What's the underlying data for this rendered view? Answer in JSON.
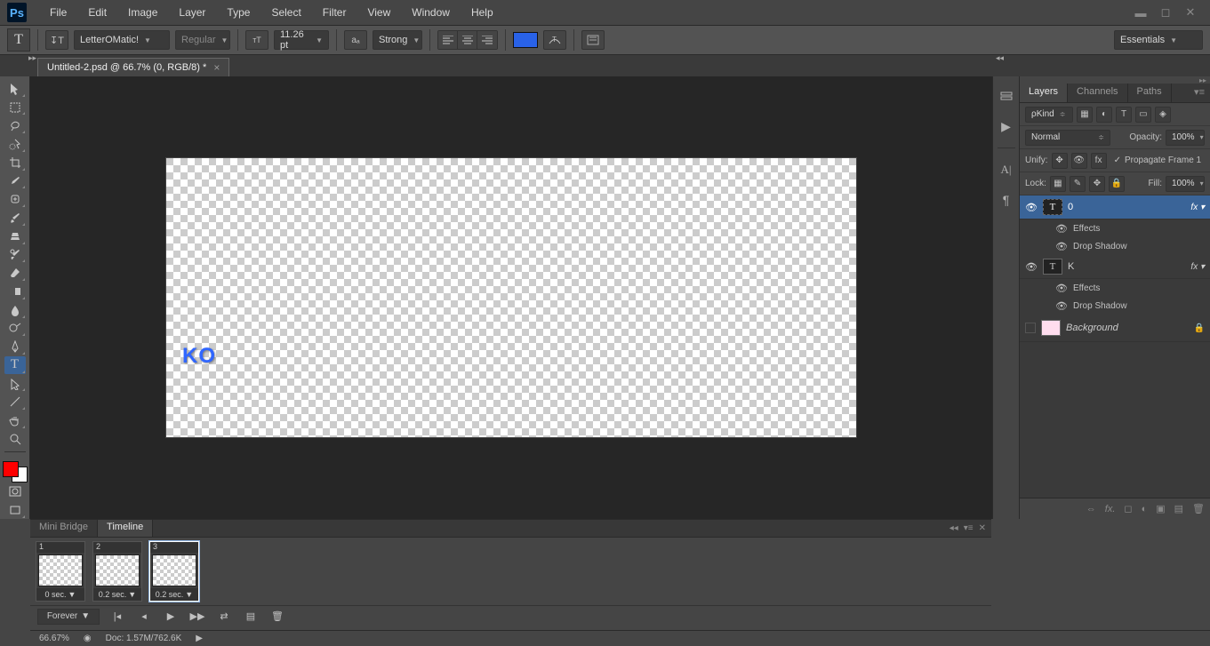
{
  "app": {
    "logo": "Ps"
  },
  "menu": [
    "File",
    "Edit",
    "Image",
    "Layer",
    "Type",
    "Select",
    "Filter",
    "View",
    "Window",
    "Help"
  ],
  "options": {
    "font": "LetterOMatic!",
    "fontStyle": "Regular",
    "fontSize": "11.26 pt",
    "aa": "Strong",
    "workspace": "Essentials"
  },
  "docTab": {
    "title": "Untitled-2.psd @ 66.7% (0, RGB/8) *"
  },
  "canvas": {
    "text": "KO"
  },
  "layers": {
    "tabs": [
      "Layers",
      "Channels",
      "Paths"
    ],
    "kind": "Kind",
    "blend": "Normal",
    "opacityLabel": "Opacity:",
    "opacity": "100%",
    "unifyLabel": "Unify:",
    "propagate": "Propagate Frame 1",
    "lockLabel": "Lock:",
    "fillLabel": "Fill:",
    "fill": "100%",
    "items": [
      {
        "name": "0",
        "effects": "Effects",
        "drop": "Drop Shadow",
        "visible": true,
        "selected": true
      },
      {
        "name": "K",
        "effects": "Effects",
        "drop": "Drop Shadow",
        "visible": true,
        "selected": false
      },
      {
        "name": "Background",
        "bg": true,
        "visible": false
      }
    ]
  },
  "timeline": {
    "tabs": [
      "Mini Bridge",
      "Timeline"
    ],
    "frames": [
      {
        "num": "1",
        "delay": "0 sec."
      },
      {
        "num": "2",
        "delay": "0.2 sec."
      },
      {
        "num": "3",
        "delay": "0.2 sec.",
        "selected": true
      }
    ],
    "loop": "Forever"
  },
  "status": {
    "zoom": "66.67%",
    "doc": "Doc: 1.57M/762.6K"
  }
}
